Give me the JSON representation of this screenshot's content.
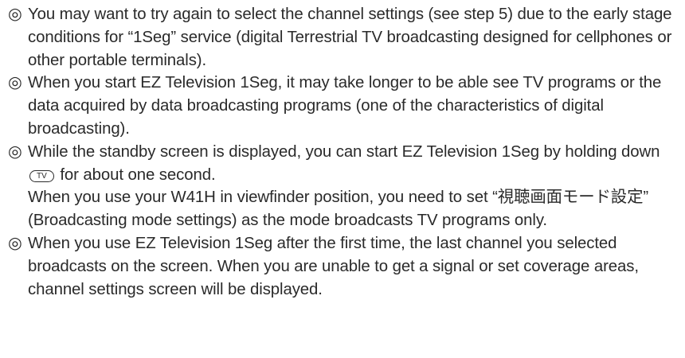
{
  "notes": [
    {
      "bullet": "◎",
      "text": "You may want to try again to select the channel settings (see step 5) due to the early stage conditions for “1Seg” service (digital Terrestrial TV broadcasting designed for cellphones or other portable terminals)."
    },
    {
      "bullet": "◎",
      "text": "When you start EZ Television 1Seg, it may take longer to be able see TV programs or the data acquired by data broadcasting programs (one of the characteristics of digital broadcasting)."
    },
    {
      "bullet": "◎",
      "text_before_key": "While the standby screen is displayed, you can start EZ Television 1Seg by holding down",
      "key_label": "TV",
      "text_after_key": "for about one second.",
      "text_line2": "When you use your W41H in viewfinder position, you need to set “視聴画面モード設定” (Broadcasting mode settings) as the mode broadcasts TV programs only."
    },
    {
      "bullet": "◎",
      "text": "When you use EZ Television 1Seg after the first time, the last channel you selected broadcasts on the screen. When you are unable to get a signal or set coverage areas, channel settings screen will be displayed."
    }
  ]
}
